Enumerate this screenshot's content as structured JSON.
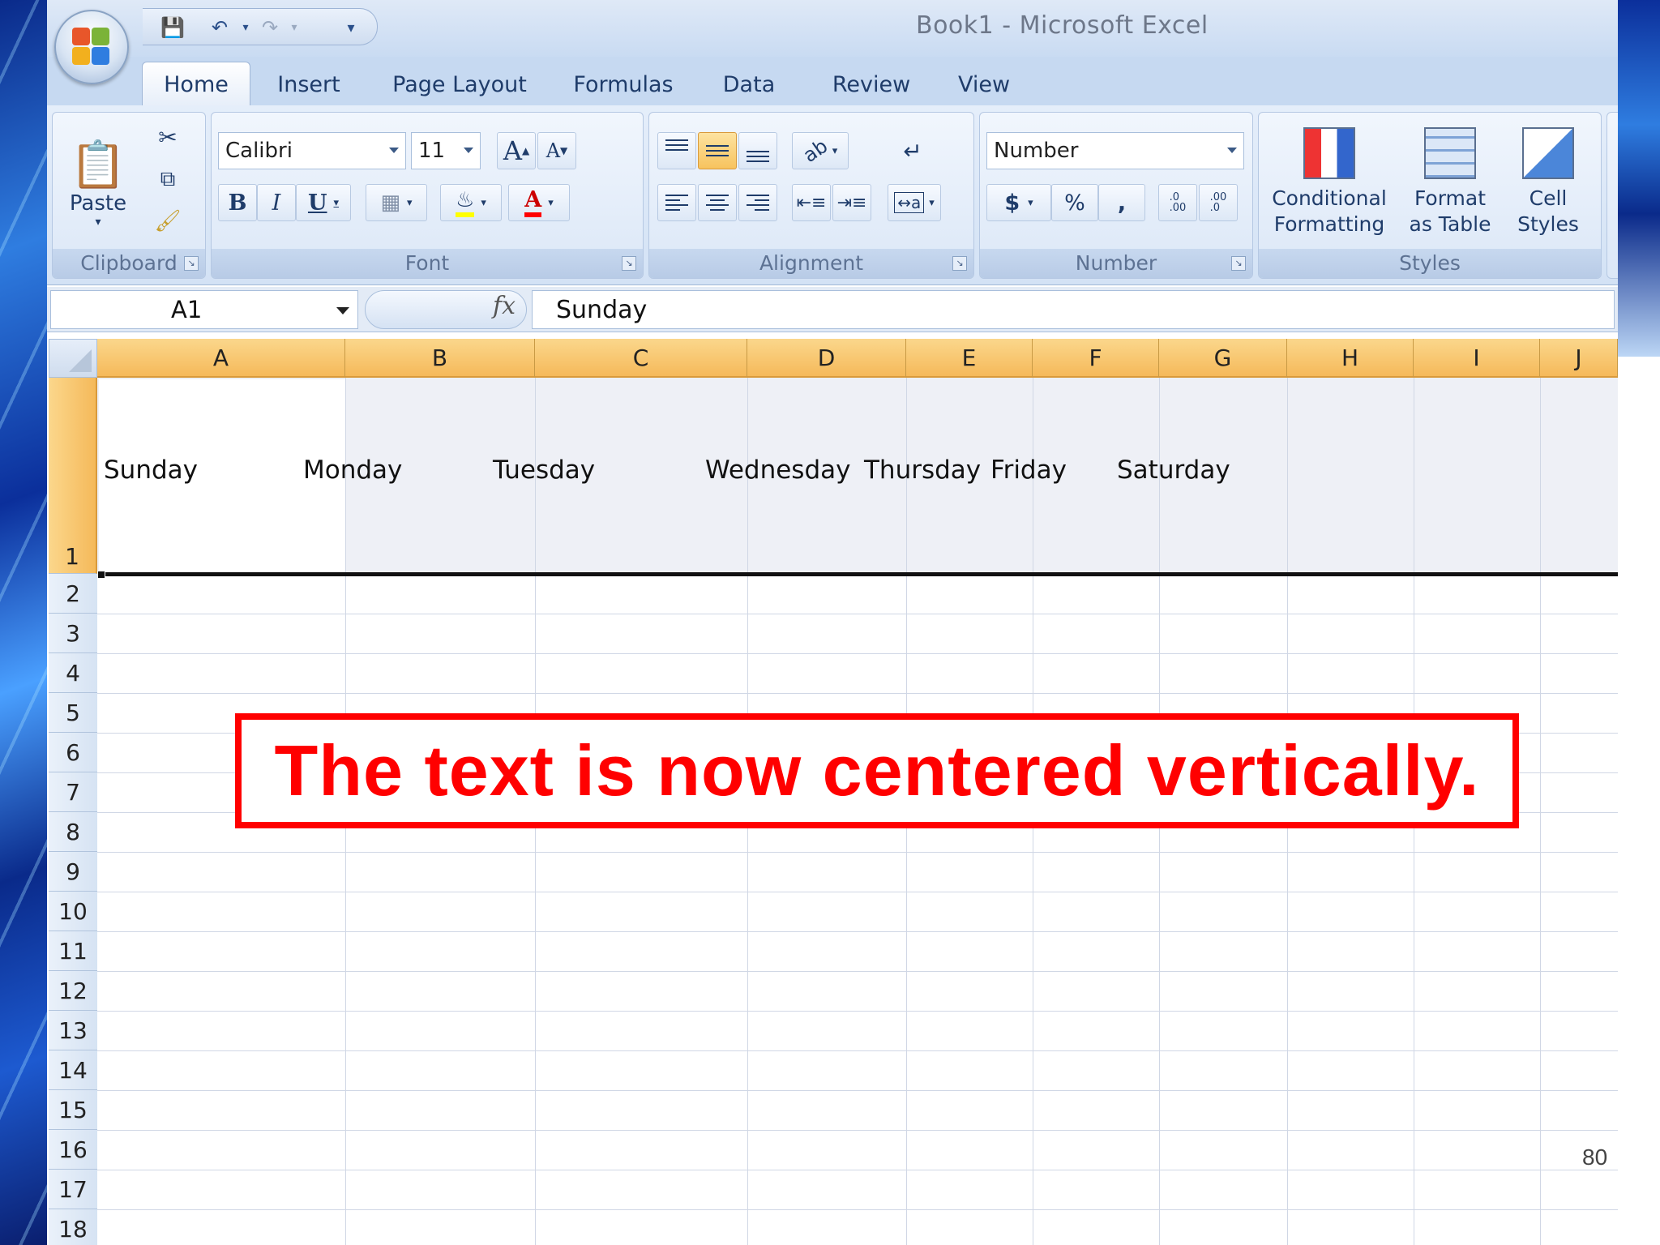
{
  "window": {
    "title": "Book1  -  Microsoft Excel"
  },
  "ribbon_tabs": [
    {
      "label": "Home",
      "active": true
    },
    {
      "label": "Insert"
    },
    {
      "label": "Page Layout"
    },
    {
      "label": "Formulas"
    },
    {
      "label": "Data"
    },
    {
      "label": "Review"
    },
    {
      "label": "View"
    }
  ],
  "clipboard": {
    "paste_label": "Paste",
    "group_label": "Clipboard"
  },
  "font": {
    "name": "Calibri",
    "size": "11",
    "group_label": "Font",
    "bold": "B",
    "italic": "I",
    "underline": "U",
    "grow": "A",
    "shrink": "A",
    "color_letter": "A"
  },
  "alignment": {
    "group_label": "Alignment"
  },
  "number": {
    "format": "Number",
    "group_label": "Number",
    "currency": "$",
    "percent": "%",
    "comma": ",",
    "inc_decimal": ".0\n.00",
    "dec_decimal": ".00\n.0"
  },
  "styles": {
    "group_label": "Styles",
    "conditional": "Conditional\nFormatting",
    "format_table": "Format\nas Table",
    "cell_styles": "Cell\nStyles"
  },
  "formula_bar": {
    "name_box": "A1",
    "fx": "fx",
    "value": "Sunday"
  },
  "columns": [
    "A",
    "B",
    "C",
    "D",
    "E",
    "F",
    "G",
    "H",
    "I",
    "J"
  ],
  "rows": [
    "1",
    "2",
    "3",
    "4",
    "5",
    "6",
    "7",
    "8",
    "9",
    "10",
    "11",
    "12",
    "13",
    "14",
    "15",
    "16",
    "17",
    "18"
  ],
  "row1_cells": [
    "Sunday",
    "Monday",
    "Tuesday",
    "Wednesday",
    "Thursday",
    "Friday",
    "Saturday"
  ],
  "callout": {
    "text": "The text is now centered vertically."
  },
  "page_number": "80",
  "colors": {
    "column_header_selected": "#f5b95a",
    "callout_red": "#ff0000",
    "ribbon_blue": "#c6d9f1"
  }
}
